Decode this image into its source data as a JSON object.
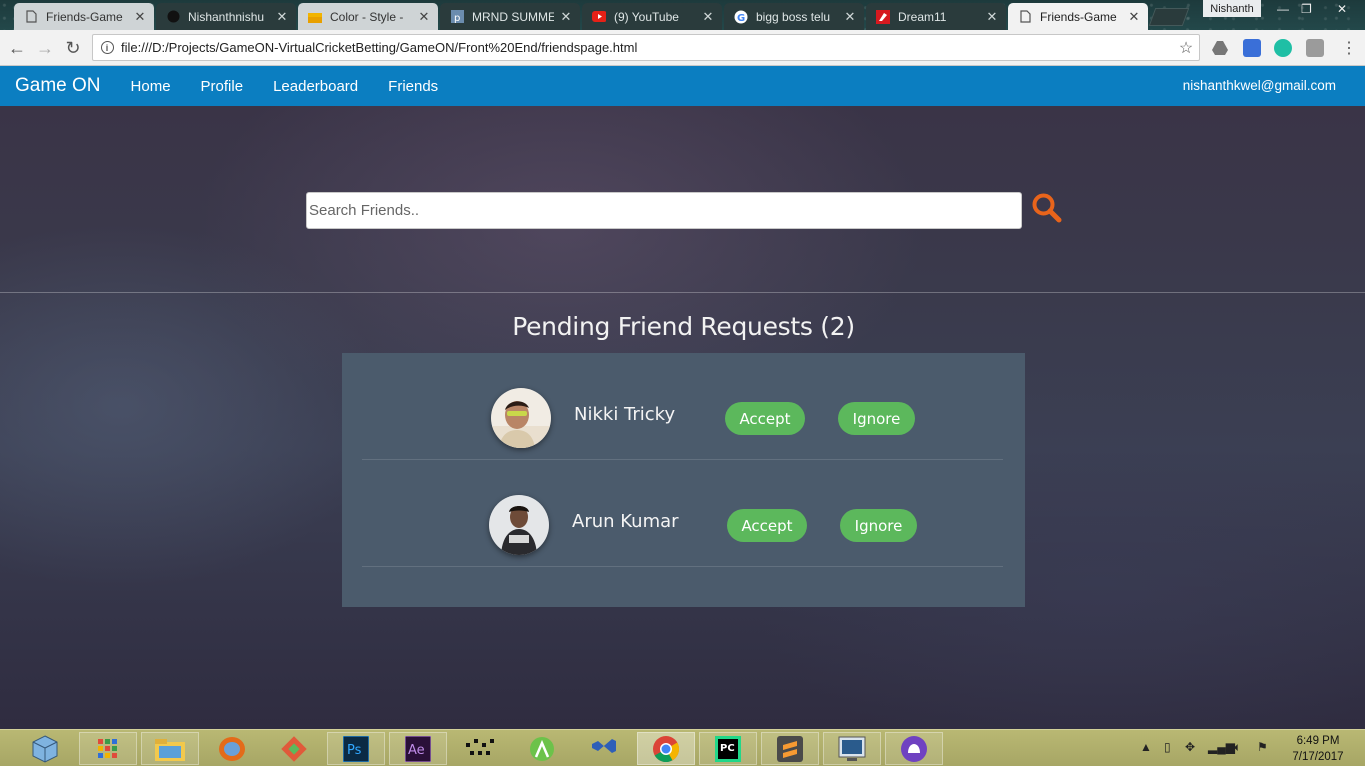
{
  "browser": {
    "tabs": [
      {
        "title": "Friends-Game",
        "state": "normal"
      },
      {
        "title": "Nishanthnishu",
        "state": "dark"
      },
      {
        "title": "Color - Style -",
        "state": "normal"
      },
      {
        "title": "MRND SUMME",
        "state": "dark"
      },
      {
        "title": "(9) YouTube",
        "state": "dark"
      },
      {
        "title": "bigg boss telu",
        "state": "dark"
      },
      {
        "title": "Dream11",
        "state": "dark"
      },
      {
        "title": "Friends-Game",
        "state": "active"
      }
    ],
    "user_chip": "Nishanth",
    "url": "file:///D:/Projects/GameON-VirtualCricketBetting/GameON/Front%20End/friendspage.html"
  },
  "navbar": {
    "brand": "Game ON",
    "links": [
      "Home",
      "Profile",
      "Leaderboard",
      "Friends"
    ],
    "user_email": "nishanthkwel@gmail.com"
  },
  "search": {
    "placeholder": "Search Friends.."
  },
  "requests": {
    "title": "Pending Friend Requests (2)",
    "items": [
      {
        "name": "Nikki Tricky",
        "accept_label": "Accept",
        "ignore_label": "Ignore"
      },
      {
        "name": "Arun Kumar",
        "accept_label": "Accept",
        "ignore_label": "Ignore"
      }
    ]
  },
  "colors": {
    "navbar": "#0b7ec1",
    "button_green": "#5cb85c",
    "search_icon": "#e8641b",
    "panel": "#4b5b6c"
  },
  "taskbar": {
    "time": "6:49 PM",
    "date": "7/17/2017"
  }
}
